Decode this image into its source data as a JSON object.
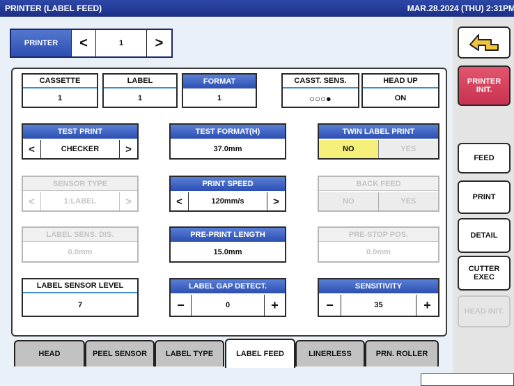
{
  "titlebar": {
    "title": "PRINTER (LABEL FEED)",
    "datetime": "MAR.28.2024 (THU)  2:31PM"
  },
  "nav": {
    "label": "PRINTER",
    "prev": "<",
    "value": "1",
    "next": ">"
  },
  "fields": {
    "cassette": {
      "header": "CASSETTE",
      "value": "1"
    },
    "label": {
      "header": "LABEL",
      "value": "1"
    },
    "format": {
      "header": "FORMAT",
      "value": "1"
    },
    "casst_sens": {
      "header": "CASST. SENS.",
      "value": "○○○●"
    },
    "head_up": {
      "header": "HEAD UP",
      "value": "ON"
    },
    "test_print": {
      "header": "TEST PRINT",
      "value": "CHECKER",
      "left": "<",
      "right": ">"
    },
    "test_format": {
      "header": "TEST FORMAT(H)",
      "value": "37.0mm"
    },
    "twin_label": {
      "header": "TWIN LABEL PRINT",
      "no": "NO",
      "yes": "YES"
    },
    "sensor_type": {
      "header": "SENSOR TYPE",
      "value": "1:LABEL",
      "left": "<",
      "right": ">"
    },
    "print_speed": {
      "header": "PRINT SPEED",
      "value": "120mm/s",
      "left": "<",
      "right": ">"
    },
    "back_feed": {
      "header": "BACK FEED",
      "no": "NO",
      "yes": "YES"
    },
    "label_sens_dis": {
      "header": "LABEL SENS. DIS.",
      "value": "0.0mm"
    },
    "pre_print_length": {
      "header": "PRE-PRINT LENGTH",
      "value": "15.0mm"
    },
    "pre_stop_pos": {
      "header": "PRE-STOP POS.",
      "value": "0.0mm"
    },
    "label_sensor_level": {
      "header": "LABEL SENSOR LEVEL",
      "value": "7"
    },
    "label_gap_detect": {
      "header": "LABEL GAP DETECT.",
      "value": "0",
      "minus": "−",
      "plus": "+"
    },
    "sensitivity": {
      "header": "SENSITIVITY",
      "value": "35",
      "minus": "−",
      "plus": "+"
    }
  },
  "tabs": [
    "HEAD",
    "PEEL SENSOR",
    "LABEL TYPE",
    "LABEL FEED",
    "LINERLESS",
    "PRN. ROLLER"
  ],
  "side": {
    "printer_init": "PRINTER\nINIT.",
    "feed": "FEED",
    "print": "PRINT",
    "detail": "DETAIL",
    "cutter_exec": "CUTTER\nEXEC",
    "head_init": "HEAD INIT."
  },
  "colors": {
    "title_bar": "#1c2f86",
    "header_blue": "#2c4fb2",
    "printer_init": "#d8425e",
    "selected_yellow": "#f4f07a"
  }
}
